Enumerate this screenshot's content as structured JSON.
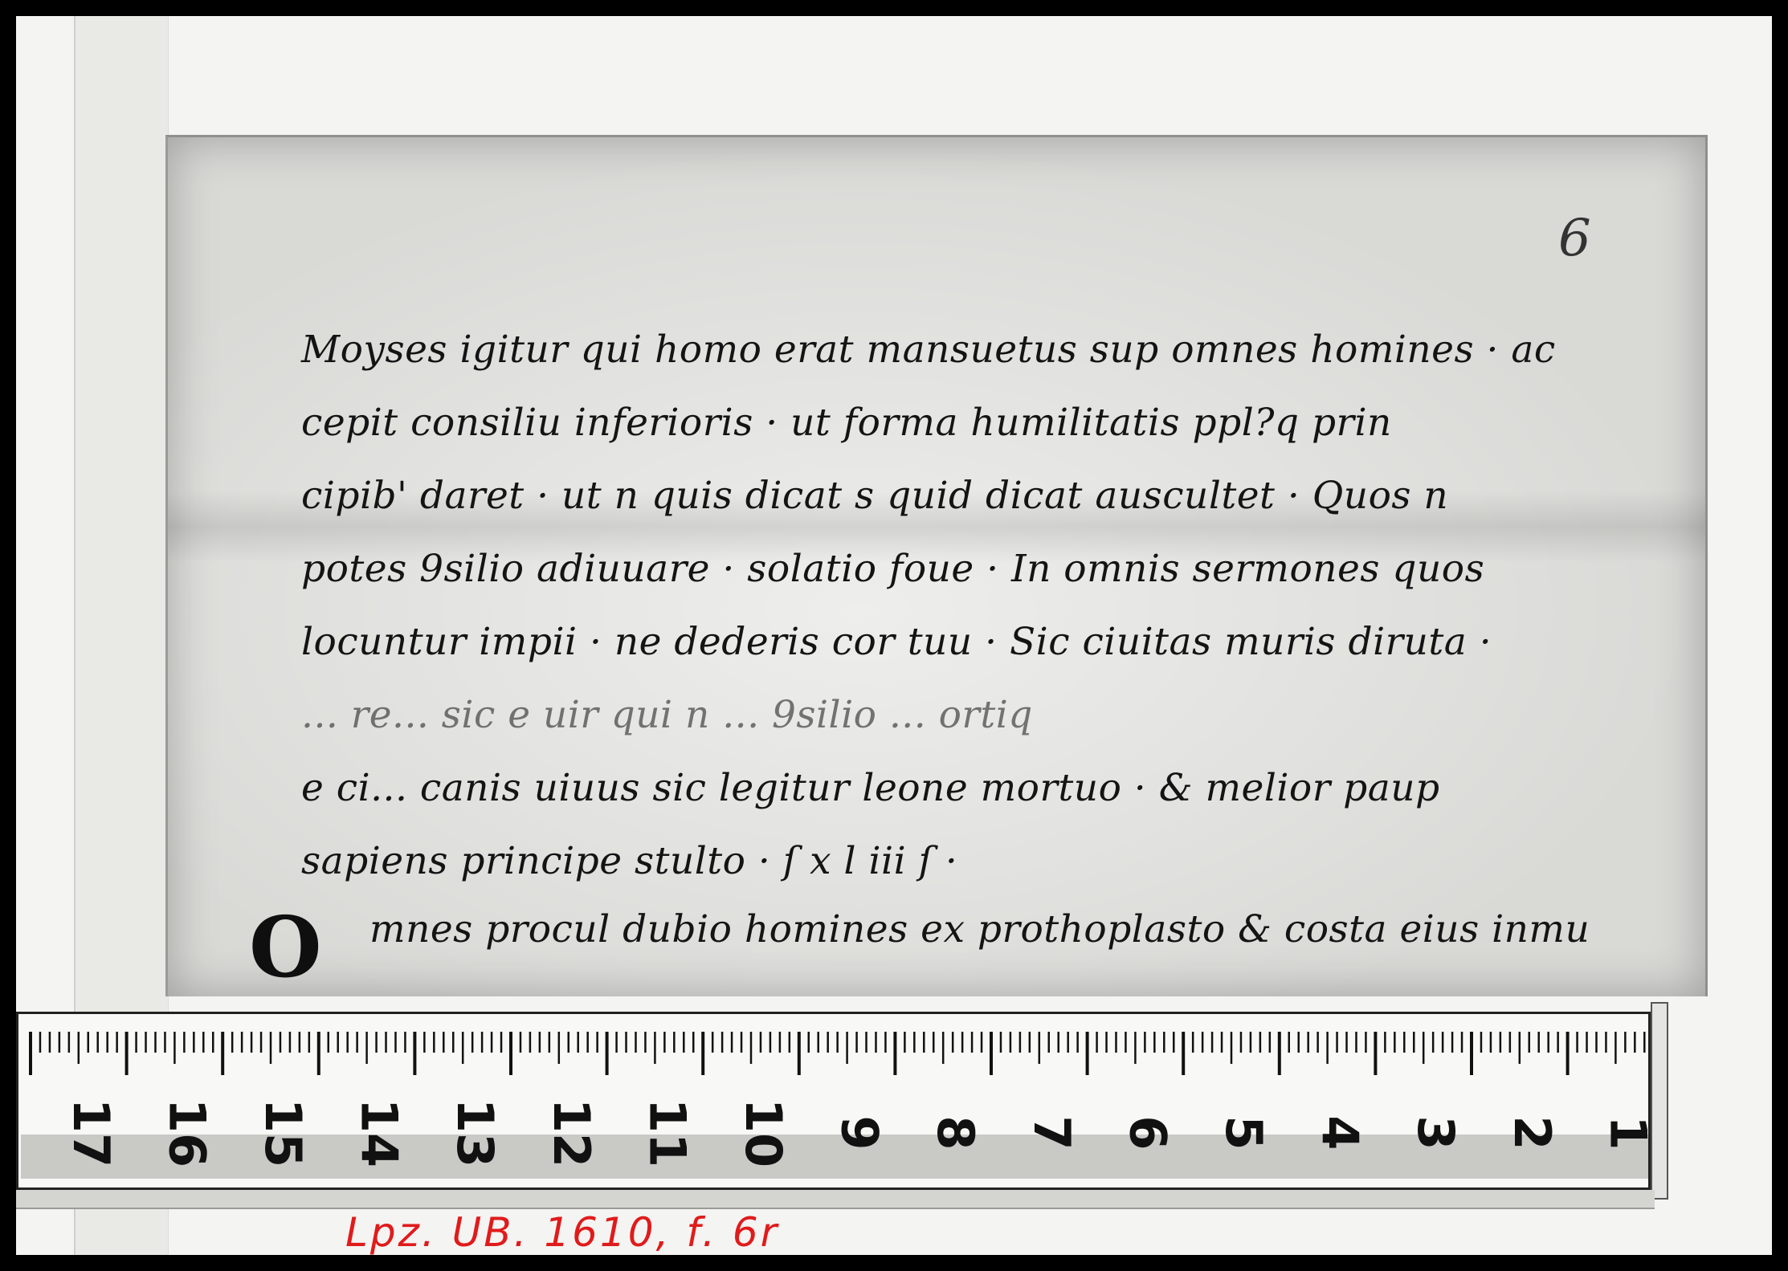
{
  "manuscript": {
    "folio_number": "6",
    "lines": [
      "Moyses igitur qui homo erat mansuetus sup omnes homines · ac",
      "cepit consiliu inferioris · ut forma humilitatis ppl?q prin",
      "cipib' daret · ut n quis dicat s quid dicat auscultet · Quos n",
      "potes 9silio adiuuare · solatio foue · In omnis sermones quos",
      "locuntur impii · ne dederis cor tuu · Sic ciuitas muris diruta ·",
      "... re... sic e uir qui n ... 9silio ... ortiq",
      "e ci... canis uiuus sic legitur leone mortuo · & melior paup",
      "sapiens principe stulto · ſ x l iii ſ ·"
    ],
    "initial": "O",
    "last_line": "mnes procul dubio homines ex prothoplasto & costa eius inmu"
  },
  "ruler": {
    "numbers": [
      "17",
      "16",
      "15",
      "14",
      "13",
      "12",
      "11",
      "10",
      "9",
      "8",
      "7",
      "6",
      "5",
      "4",
      "3",
      "2",
      "1"
    ]
  },
  "shelfmark": {
    "text": "Lpz. UB. 1610, f. 6r",
    "color": "#e01b1b"
  }
}
